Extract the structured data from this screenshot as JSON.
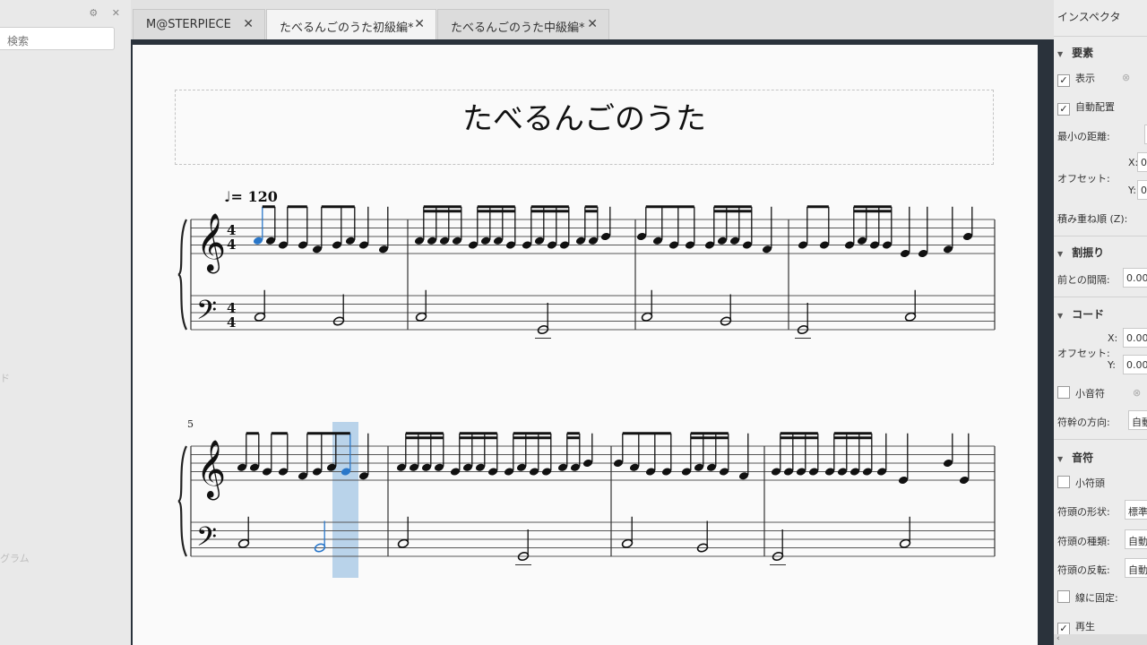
{
  "left_panel": {
    "top_icons": "⚙ ✕",
    "search_placeholder": "検索",
    "fragment_1": "ド",
    "fragment_2": "グラム"
  },
  "tabs": [
    {
      "label": "M@STERPIECE",
      "close": "✕"
    },
    {
      "label": "たべるんごのうた初級編*",
      "close": "✕"
    },
    {
      "label": "たべるんごのうた中級編*",
      "close": "✕"
    }
  ],
  "score": {
    "title": "たべるんごのうた",
    "tempo": "♩= 120",
    "system2_measure_number": "5",
    "time_signature": {
      "numerator": "4",
      "denominator": "4"
    }
  },
  "inspector": {
    "title": "インスペクタ",
    "sections": {
      "element": {
        "label": "要素",
        "show": "表示",
        "auto_place": "自動配置",
        "min_distance": "最小の距離:",
        "offset": "オフセット:",
        "x": "X:",
        "x_value": "0",
        "y": "Y:",
        "y_value": "0",
        "stacking": "積み重ね順 (Z):"
      },
      "segment": {
        "label": "割振り",
        "leading_space": "前との間隔:",
        "leading_value": "0.00"
      },
      "chord": {
        "label": "コード",
        "offset": "オフセット:",
        "x": "X:",
        "x_value": "0.00",
        "y": "Y:",
        "y_value": "0.00",
        "small": "小音符",
        "stem_direction": "符幹の方向:",
        "stem_value": "自動"
      },
      "note": {
        "label": "音符",
        "small": "小符頭",
        "head_group": "符頭の形状:",
        "head_group_value": "標準",
        "head_type": "符頭の種類:",
        "head_type_value": "自動",
        "mirror": "符頭の反転:",
        "mirror_value": "自動",
        "fix_line": "線に固定:",
        "play": "再生"
      }
    },
    "scroll_hint": "‹"
  },
  "colors": {
    "selection": "#2a77c9",
    "highlight": "#b9d3ea",
    "page_bg": "#fafafa",
    "frame": "#2a323b"
  }
}
